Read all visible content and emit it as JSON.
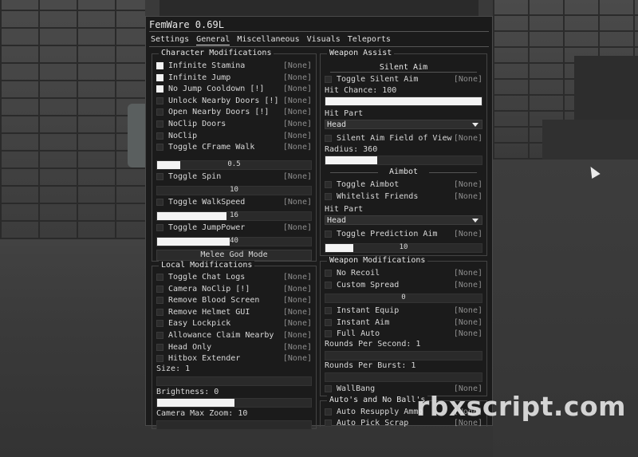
{
  "window": {
    "title": "FemWare 0.69L"
  },
  "tabs": [
    "Settings",
    "General",
    "Miscellaneous",
    "Visuals",
    "Teleports"
  ],
  "active_tab": "General",
  "watermark": "rbxscript.com",
  "none_label": "[None]",
  "character": {
    "title": "Character Modifications",
    "items": [
      {
        "label": "Infinite Stamina",
        "on": true
      },
      {
        "label": "Infinite Jump",
        "on": true
      },
      {
        "label": "No Jump Cooldown [!]",
        "on": true
      },
      {
        "label": "Unlock Nearby Doors [!]",
        "on": false
      },
      {
        "label": "Open Nearby Doors [!]",
        "on": false
      },
      {
        "label": "NoClip Doors",
        "on": false
      },
      {
        "label": "NoClip",
        "on": false
      },
      {
        "label": "Toggle CFrame Walk",
        "on": false
      }
    ],
    "cframe_speed": "0.5",
    "cframe_fill": 0.15,
    "spin_label": "Toggle Spin",
    "spin_value": "10",
    "spin_fill": 0,
    "walkspeed_label": "Toggle WalkSpeed",
    "walkspeed_value": "16",
    "walkspeed_fill": 0.45,
    "jumppower_label": "Toggle JumpPower",
    "jumppower_value": "40",
    "jumppower_fill": 0.47,
    "melee_button": "Melee God Mode"
  },
  "local": {
    "title": "Local Modifications",
    "items": [
      {
        "label": "Toggle Chat Logs",
        "on": false
      },
      {
        "label": "Camera NoClip [!]",
        "on": false
      },
      {
        "label": "Remove Blood Screen",
        "on": false
      },
      {
        "label": "Remove Helmet GUI",
        "on": false
      },
      {
        "label": "Easy Lockpick",
        "on": false
      },
      {
        "label": "Allowance Claim Nearby",
        "on": false
      },
      {
        "label": "Head Only",
        "on": false
      },
      {
        "label": "Hitbox Extender",
        "on": false
      }
    ],
    "size_label": "Size: 1",
    "size_fill": 0,
    "brightness_label": "Brightness: 0",
    "brightness_fill": 0.5,
    "zoom_label": "Camera Max Zoom: 10",
    "zoom_fill": 0
  },
  "weapon_assist": {
    "title": "Weapon Assist",
    "silent_aim_title": "Silent Aim",
    "toggle_silent": "Toggle Silent Aim",
    "hit_chance_label": "Hit Chance: 100",
    "hit_chance_fill": 1.0,
    "hit_part_label": "Hit Part",
    "hit_part_value": "Head",
    "fov_label": "Silent Aim Field of View",
    "radius_label": "Radius: 360",
    "radius_fill": 0.33,
    "aimbot_title": "Aimbot",
    "toggle_aimbot": "Toggle Aimbot",
    "whitelist": "Whitelist Friends",
    "aimbot_hit_part_label": "Hit Part",
    "aimbot_hit_part_value": "Head",
    "prediction": "Toggle Prediction Aim",
    "prediction_value": "10",
    "prediction_fill": 0.18
  },
  "weapon_mods": {
    "title": "Weapon Modifications",
    "no_recoil": "No Recoil",
    "custom_spread": "Custom Spread",
    "spread_value": "0",
    "spread_fill": 0,
    "instant_equip": "Instant Equip",
    "instant_aim": "Instant Aim",
    "full_auto": "Full Auto",
    "rps_label": "Rounds Per Second: 1",
    "rps_fill": 0,
    "rpb_label": "Rounds Per Burst: 1",
    "rpb_fill": 0,
    "wallbang": "WallBang"
  },
  "autos": {
    "title": "Auto's and No Ball's",
    "resupply": "Auto Resupply Ammo",
    "scrap": "Auto Pick Scrap"
  }
}
